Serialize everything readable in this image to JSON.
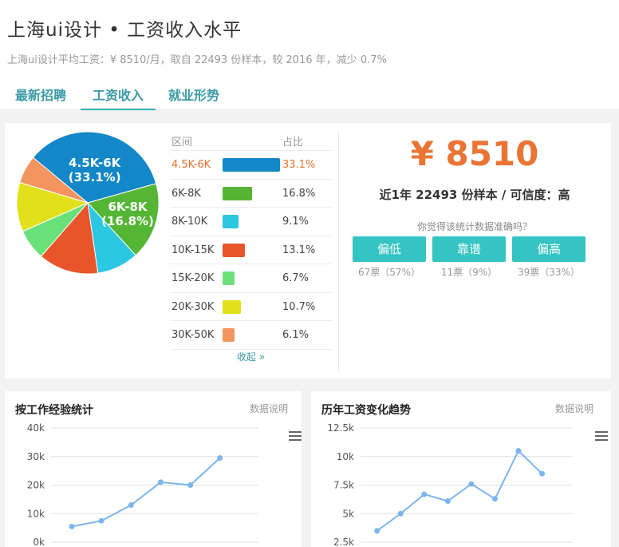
{
  "page": {
    "title": "上海ui设计 • 工资收入水平",
    "subtitle": "上海ui设计平均工资：¥ 8510/月，取自 22493 份样本，较 2016 年，减少 0.7%"
  },
  "tabs": [
    {
      "label": "最新招聘",
      "active": false
    },
    {
      "label": "工资收入",
      "active": true
    },
    {
      "label": "就业形势",
      "active": false
    }
  ],
  "distribution": {
    "col_range": "区间",
    "col_ratio": "占比",
    "collapse": "收起 »",
    "rows": [
      {
        "range": "4.5K-6K",
        "pct": "33.1%",
        "value": 33.1,
        "color": "#1387c8",
        "highlight": true
      },
      {
        "range": "6K-8K",
        "pct": "16.8%",
        "value": 16.8,
        "color": "#54b634"
      },
      {
        "range": "8K-10K",
        "pct": "9.1%",
        "value": 9.1,
        "color": "#2cc7e2"
      },
      {
        "range": "10K-15K",
        "pct": "13.1%",
        "value": 13.1,
        "color": "#e8552a"
      },
      {
        "range": "15K-20K",
        "pct": "6.7%",
        "value": 6.7,
        "color": "#6ae07a"
      },
      {
        "range": "20K-30K",
        "pct": "10.7%",
        "value": 10.7,
        "color": "#e2e01a"
      },
      {
        "range": "30K-50K",
        "pct": "6.1%",
        "value": 6.1,
        "color": "#f4945e"
      }
    ],
    "pie_labels": [
      {
        "name": "4.5K-6K",
        "pct": "(33.1%)"
      },
      {
        "name": "6K-8K",
        "pct": "(16.8%)"
      }
    ]
  },
  "summary": {
    "avg": "¥ 8510",
    "sample": "近1年 22493 份样本 / 可信度：高",
    "question": "你觉得该统计数据准确吗？",
    "votes": [
      {
        "label": "偏低",
        "count": "67票（57%）"
      },
      {
        "label": "靠谱",
        "count": "11票（9%）"
      },
      {
        "label": "偏高",
        "count": "39票（33%）"
      }
    ]
  },
  "experience_chart": {
    "title": "按工作经验统计",
    "note": "数据说明"
  },
  "trend_chart": {
    "title": "历年工资变化趋势",
    "note": "数据说明"
  },
  "chart_data": [
    {
      "type": "pie",
      "categories": [
        "4.5K-6K",
        "6K-8K",
        "8K-10K",
        "10K-15K",
        "15K-20K",
        "20K-30K",
        "30K-50K"
      ],
      "values": [
        33.1,
        16.8,
        9.1,
        13.1,
        6.7,
        10.7,
        6.1
      ],
      "colors": [
        "#1387c8",
        "#54b634",
        "#2cc7e2",
        "#e8552a",
        "#6ae07a",
        "#e2e01a",
        "#f4945e"
      ]
    },
    {
      "type": "line",
      "title": "按工作经验统计",
      "yticks": [
        "40k",
        "30k",
        "20k",
        "10k",
        "0k"
      ],
      "ylim": [
        0,
        40000
      ],
      "values": [
        5500,
        7500,
        13000,
        21000,
        20000,
        29500
      ],
      "color": "#7cb5ec"
    },
    {
      "type": "line",
      "title": "历年工资变化趋势",
      "yticks": [
        "12.5k",
        "10k",
        "7.5k",
        "5k",
        "2.5k"
      ],
      "ylim": [
        2500,
        12500
      ],
      "values": [
        3500,
        5000,
        6700,
        6100,
        7600,
        6300,
        10500,
        8500
      ],
      "color": "#7cb5ec"
    }
  ]
}
